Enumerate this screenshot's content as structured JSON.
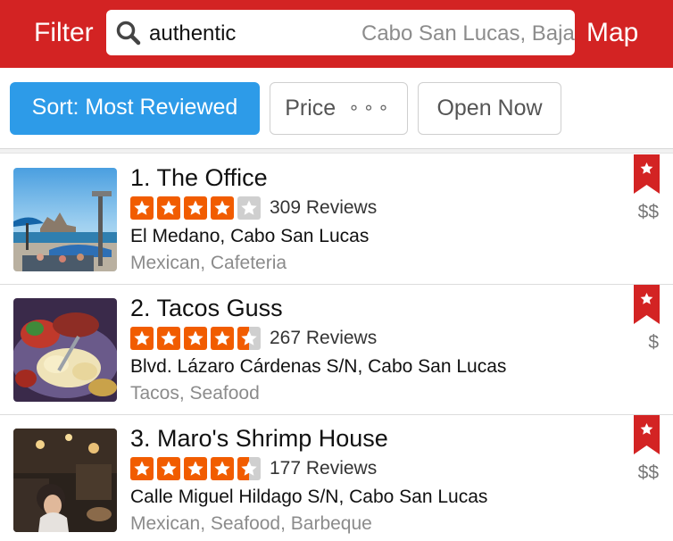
{
  "header": {
    "filter_label": "Filter",
    "map_label": "Map",
    "search_term": "authentic",
    "search_location": "Cabo San Lucas, Baja California Sur"
  },
  "chips": {
    "sort_label": "Sort: Most Reviewed",
    "price_label": "Price",
    "price_dots": "∘∘∘",
    "open_now_label": "Open Now"
  },
  "colors": {
    "brand_red": "#d32323",
    "sort_blue": "#2d9be8",
    "star_orange": "#f15c00"
  },
  "results": [
    {
      "title": "1. The Office",
      "rating": 4,
      "reviews": "309 Reviews",
      "address": "El Medano, Cabo San Lucas",
      "categories": "Mexican, Cafeteria",
      "price": "$$"
    },
    {
      "title": "2. Tacos Guss",
      "rating": 4.5,
      "reviews": "267 Reviews",
      "address": "Blvd. Lázaro Cárdenas S/N, Cabo San Lucas",
      "categories": "Tacos, Seafood",
      "price": "$"
    },
    {
      "title": "3. Maro's Shrimp House",
      "rating": 4.5,
      "reviews": "177 Reviews",
      "address": "Calle Miguel Hildago S/N, Cabo San Lucas",
      "categories": "Mexican, Seafood, Barbeque",
      "price": "$$"
    }
  ]
}
